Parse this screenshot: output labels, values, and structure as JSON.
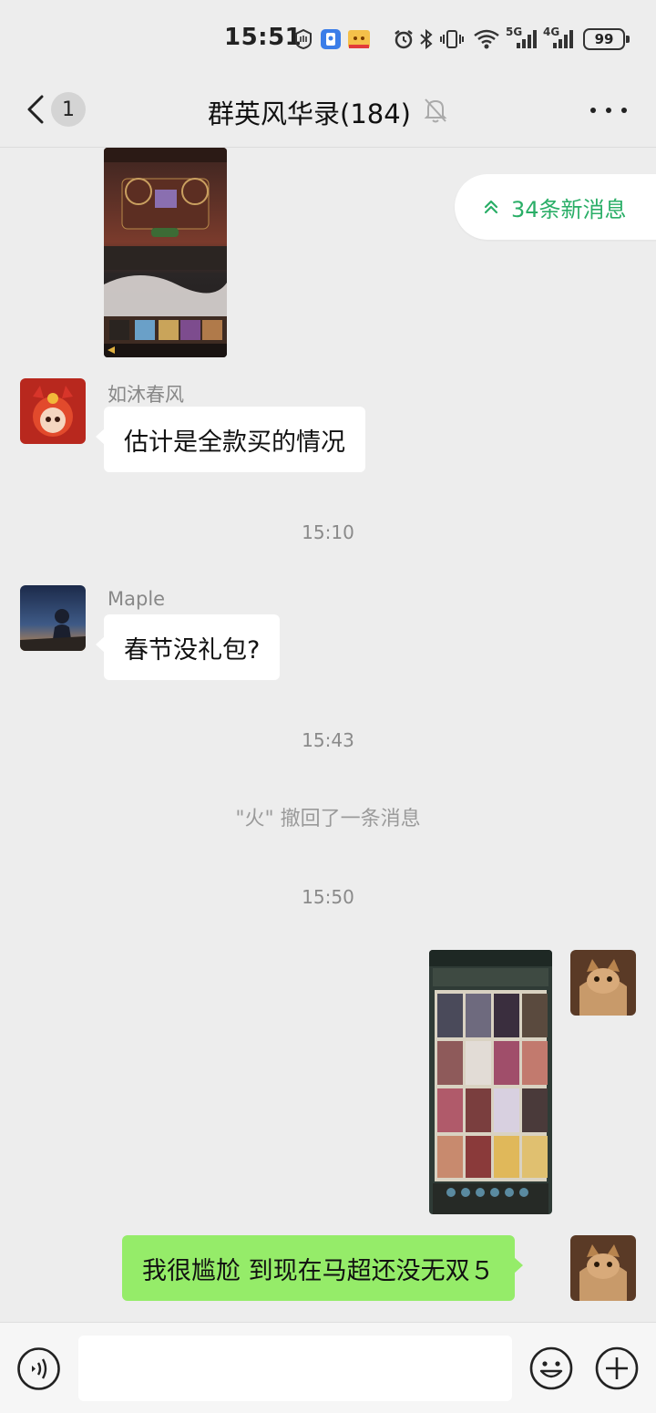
{
  "status_bar": {
    "time": "15:51",
    "battery": "99",
    "network_1": "5G",
    "network_2": "4G",
    "icons": [
      "hand-icon",
      "app-icon",
      "app-icon",
      "alarm-icon",
      "bluetooth-icon",
      "vibrate-icon",
      "wifi-icon",
      "signal-icon",
      "signal-icon",
      "battery-icon"
    ]
  },
  "nav": {
    "unread_count": "1",
    "title": "群英风华录(184)",
    "icons": [
      "back-icon",
      "mute-bell-icon",
      "more-icon"
    ]
  },
  "new_messages": {
    "label": "34条新消息",
    "accent": "#2aae67"
  },
  "messages": [
    {
      "type": "image",
      "side": "left"
    },
    {
      "type": "text",
      "side": "left",
      "sender": "如沐春风",
      "text": "估计是全款买的情况"
    },
    {
      "type": "time",
      "text": "15:10"
    },
    {
      "type": "text",
      "side": "left",
      "sender": "Maple",
      "text": "春节没礼包?"
    },
    {
      "type": "time",
      "text": "15:43"
    },
    {
      "type": "system",
      "text": "\"火\" 撤回了一条消息"
    },
    {
      "type": "time",
      "text": "15:50"
    },
    {
      "type": "image",
      "side": "right"
    },
    {
      "type": "text",
      "side": "right",
      "text": "我很尴尬 到现在马超还没无双５"
    }
  ],
  "input_bar": {
    "value": "",
    "icons": [
      "voice-icon",
      "emoji-icon",
      "plus-icon"
    ]
  },
  "colors": {
    "background": "#ededed",
    "outgoing_bubble": "#95ec69",
    "incoming_bubble": "#ffffff"
  }
}
